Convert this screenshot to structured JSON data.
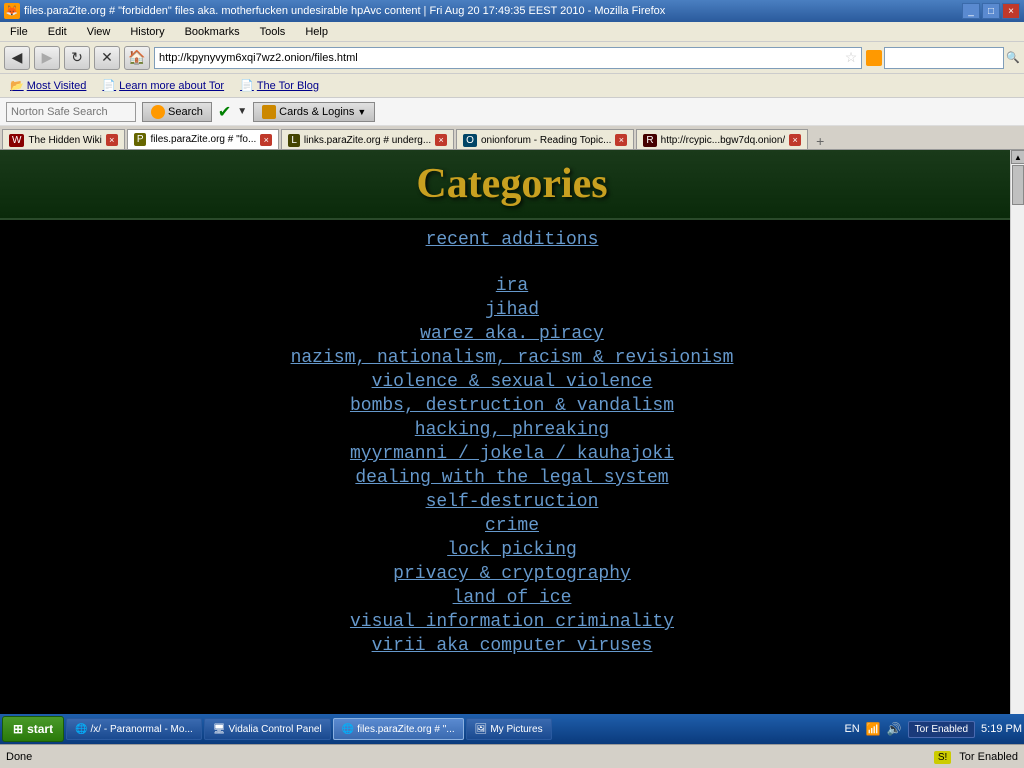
{
  "titlebar": {
    "title": "files.paraZite.org # \"forbidden\" files aka. motherfucken undesirable hpAvc content  |  Fri Aug 20 17:49:35 EEST 2010 - Mozilla Firefox",
    "icon": "🦊",
    "buttons": [
      "_",
      "□",
      "×"
    ]
  },
  "menubar": {
    "items": [
      "File",
      "Edit",
      "View",
      "History",
      "Bookmarks",
      "Tools",
      "Help"
    ]
  },
  "navbar": {
    "back_btn": "◀",
    "forward_btn": "▶",
    "reload_btn": "↻",
    "stop_btn": "✕",
    "home_btn": "🏠",
    "address": "http://kpynyvym6xqi7wz2.onion/files.html",
    "star": "☆",
    "search_placeholder": ""
  },
  "bookmarks": {
    "items": [
      {
        "label": "Most Visited",
        "icon": "📂"
      },
      {
        "label": "Learn more about Tor",
        "icon": "📄"
      },
      {
        "label": "The Tor Blog",
        "icon": "📄"
      }
    ]
  },
  "norton": {
    "search_placeholder": "Norton Safe Search",
    "search_btn": "Search",
    "check_icon": "✔",
    "cards_label": "Cards & Logins",
    "dropdown": "▼"
  },
  "tabs": [
    {
      "label": "The Hidden Wiki",
      "active": false,
      "icon": "W"
    },
    {
      "label": "files.paraZite.org # \"fo...",
      "active": true,
      "icon": "P"
    },
    {
      "label": "links.paraZite.org # underg...",
      "active": false,
      "icon": "L"
    },
    {
      "label": "onionforum - Reading Topic...",
      "active": false,
      "icon": "O"
    },
    {
      "label": "http://rcypic...bgw7dq.onion/",
      "active": false,
      "icon": "R"
    }
  ],
  "page": {
    "header": "Categories",
    "categories": [
      "recent additions",
      "ira",
      "jihad",
      "warez aka. piracy",
      "nazism, nationalism, racism & revisionism",
      "violence & sexual violence",
      "bombs, destruction & vandalism",
      "hacking, phreaking",
      "myyrmanni / jokela / kauhajoki",
      "dealing with the legal system",
      "self-destruction",
      "crime",
      "lock picking",
      "privacy & cryptography",
      "land of ice",
      "visual information criminality",
      "virii aka computer viruses"
    ]
  },
  "statusbar": {
    "status": "Done",
    "tor_status": "Tor Enabled",
    "language": "EN",
    "time": "5:19 PM"
  },
  "taskbar": {
    "start": "start",
    "items": [
      {
        "label": "/x/ - Paranormal - Mo...",
        "icon": "🌐",
        "active": false
      },
      {
        "label": "Vidalia Control Panel",
        "icon": "🖥",
        "active": false
      },
      {
        "label": "files.paraZite.org # \"...",
        "icon": "🌐",
        "active": true
      },
      {
        "label": "My Pictures",
        "icon": "🖼",
        "active": false
      }
    ]
  }
}
